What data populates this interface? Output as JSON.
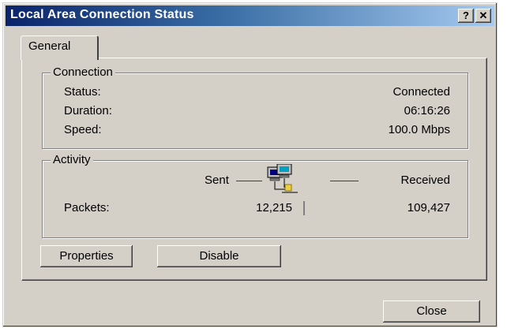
{
  "window": {
    "title": "Local Area Connection Status"
  },
  "titlebar": {
    "help_label": "?",
    "close_label": "✕"
  },
  "tabs": [
    {
      "label": "General"
    }
  ],
  "connection": {
    "group_label": "Connection",
    "status_label": "Status:",
    "status_value": "Connected",
    "duration_label": "Duration:",
    "duration_value": "06:16:26",
    "speed_label": "Speed:",
    "speed_value": "100.0 Mbps"
  },
  "activity": {
    "group_label": "Activity",
    "sent_label": "Sent",
    "received_label": "Received",
    "packets_label": "Packets:",
    "packets_sent": "12,215",
    "packets_received": "109,427"
  },
  "buttons": {
    "properties": "Properties",
    "disable": "Disable",
    "close": "Close"
  },
  "icons": {
    "network": "network-computers-icon"
  },
  "colors": {
    "titlebar_start": "#0a246a",
    "titlebar_end": "#a6caf0",
    "face": "#d4d0c8"
  }
}
